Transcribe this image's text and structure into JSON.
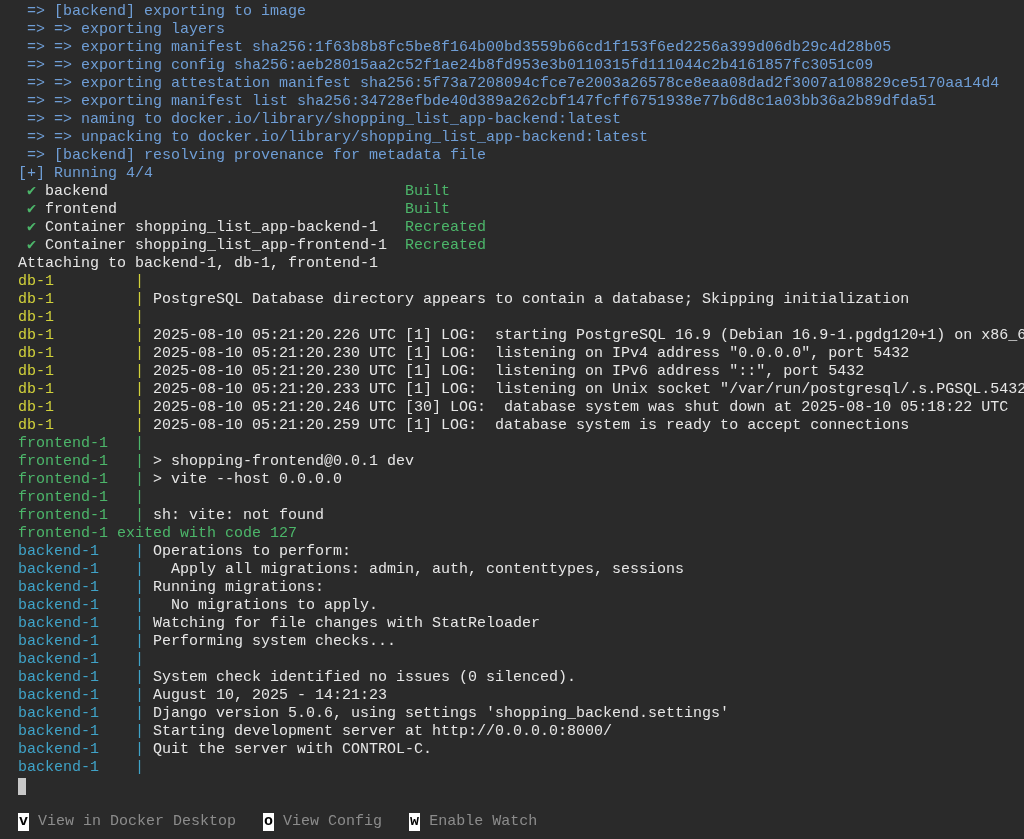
{
  "build_lines": [
    {
      "text": "=> [backend] exporting to image"
    },
    {
      "text": "=> => exporting layers"
    },
    {
      "text": "=> => exporting manifest sha256:1f63b8b8fc5be8f164b00bd3559b66cd1f153f6ed2256a399d06db29c4d28b05"
    },
    {
      "text": "=> => exporting config sha256:aeb28015aa2c52f1ae24b8fd953e3b0110315fd111044c2b4161857fc3051c09"
    },
    {
      "text": "=> => exporting attestation manifest sha256:5f73a7208094cfce7e2003a26578ce8eaa08dad2f3007a108829ce5170aa14d4"
    },
    {
      "text": "=> => exporting manifest list sha256:34728efbde40d389a262cbf147fcff6751938e77b6d8c1a03bb36a2b89dfda51"
    },
    {
      "text": "=> => naming to docker.io/library/shopping_list_app-backend:latest"
    },
    {
      "text": "=> => unpacking to docker.io/library/shopping_list_app-backend:latest"
    },
    {
      "text": "=> [backend] resolving provenance for metadata file"
    }
  ],
  "running": "[+] Running 4/4",
  "status_rows": [
    {
      "icon": "✔",
      "name": "backend",
      "result": "Built"
    },
    {
      "icon": "✔",
      "name": "frontend",
      "result": "Built"
    },
    {
      "icon": "✔",
      "name": "Container shopping_list_app-backend-1",
      "result": "Recreated"
    },
    {
      "icon": "✔",
      "name": "Container shopping_list_app-frontend-1",
      "result": "Recreated"
    }
  ],
  "attach_line": "Attaching to backend-1, db-1, frontend-1",
  "log_lines": [
    {
      "kind": "log",
      "service": "db-1",
      "color": "#d2d23a",
      "sep": "|"
    },
    {
      "kind": "log",
      "service": "db-1",
      "color": "#d2d23a",
      "sep": "|",
      "message": "PostgreSQL Database directory appears to contain a database; Skipping initialization"
    },
    {
      "kind": "log",
      "service": "db-1",
      "color": "#d2d23a",
      "sep": "|"
    },
    {
      "kind": "log",
      "service": "db-1",
      "color": "#d2d23a",
      "sep": "|",
      "message": "2025-08-10 05:21:20.226 UTC [1] LOG:  starting PostgreSQL 16.9 (Debian 16.9-1.pgdg120+1) on x86_6"
    },
    {
      "kind": "log",
      "service": "db-1",
      "color": "#d2d23a",
      "sep": "|",
      "message": "2025-08-10 05:21:20.230 UTC [1] LOG:  listening on IPv4 address \"0.0.0.0\", port 5432"
    },
    {
      "kind": "log",
      "service": "db-1",
      "color": "#d2d23a",
      "sep": "|",
      "message": "2025-08-10 05:21:20.230 UTC [1] LOG:  listening on IPv6 address \"::\", port 5432"
    },
    {
      "kind": "log",
      "service": "db-1",
      "color": "#d2d23a",
      "sep": "|",
      "message": "2025-08-10 05:21:20.233 UTC [1] LOG:  listening on Unix socket \"/var/run/postgresql/.s.PGSQL.5432"
    },
    {
      "kind": "log",
      "service": "db-1",
      "color": "#d2d23a",
      "sep": "|",
      "message": "2025-08-10 05:21:20.246 UTC [30] LOG:  database system was shut down at 2025-08-10 05:18:22 UTC"
    },
    {
      "kind": "log",
      "service": "db-1",
      "color": "#d2d23a",
      "sep": "|",
      "message": "2025-08-10 05:21:20.259 UTC [1] LOG:  database system is ready to accept connections"
    },
    {
      "kind": "log",
      "service": "frontend-1",
      "color": "#4cb66a",
      "sep": "|"
    },
    {
      "kind": "log",
      "service": "frontend-1",
      "color": "#4cb66a",
      "sep": "|",
      "message": "> shopping-frontend@0.0.1 dev"
    },
    {
      "kind": "log",
      "service": "frontend-1",
      "color": "#4cb66a",
      "sep": "|",
      "message": "> vite --host 0.0.0.0"
    },
    {
      "kind": "log",
      "service": "frontend-1",
      "color": "#4cb66a",
      "sep": "|"
    },
    {
      "kind": "log",
      "service": "frontend-1",
      "color": "#4cb66a",
      "sep": "|",
      "message": "sh: vite: not found"
    },
    {
      "kind": "exit",
      "service": "frontend-1",
      "color": "#4cb66a",
      "message": "exited with code 127"
    },
    {
      "kind": "log",
      "service": "backend-1",
      "color": "#3fa3c8",
      "sep": "|",
      "message": "Operations to perform:"
    },
    {
      "kind": "log",
      "service": "backend-1",
      "color": "#3fa3c8",
      "sep": "|",
      "message": "  Apply all migrations: admin, auth, contenttypes, sessions"
    },
    {
      "kind": "log",
      "service": "backend-1",
      "color": "#3fa3c8",
      "sep": "|",
      "message": "Running migrations:"
    },
    {
      "kind": "log",
      "service": "backend-1",
      "color": "#3fa3c8",
      "sep": "|",
      "message": "  No migrations to apply."
    },
    {
      "kind": "log",
      "service": "backend-1",
      "color": "#3fa3c8",
      "sep": "|",
      "message": "Watching for file changes with StatReloader"
    },
    {
      "kind": "log",
      "service": "backend-1",
      "color": "#3fa3c8",
      "sep": "|",
      "message": "Performing system checks..."
    },
    {
      "kind": "log",
      "service": "backend-1",
      "color": "#3fa3c8",
      "sep": "|"
    },
    {
      "kind": "log",
      "service": "backend-1",
      "color": "#3fa3c8",
      "sep": "|",
      "message": "System check identified no issues (0 silenced)."
    },
    {
      "kind": "log",
      "service": "backend-1",
      "color": "#3fa3c8",
      "sep": "|",
      "message": "August 10, 2025 - 14:21:23"
    },
    {
      "kind": "log",
      "service": "backend-1",
      "color": "#3fa3c8",
      "sep": "|",
      "message": "Django version 5.0.6, using settings 'shopping_backend.settings'"
    },
    {
      "kind": "log",
      "service": "backend-1",
      "color": "#3fa3c8",
      "sep": "|",
      "message": "Starting development server at http://0.0.0.0:8000/"
    },
    {
      "kind": "log",
      "service": "backend-1",
      "color": "#3fa3c8",
      "sep": "|",
      "message": "Quit the server with CONTROL-C."
    },
    {
      "kind": "log",
      "service": "backend-1",
      "color": "#3fa3c8",
      "sep": "|"
    }
  ],
  "shortcuts": [
    {
      "key": "v",
      "label": "View in Docker Desktop"
    },
    {
      "key": "o",
      "label": "View Config"
    },
    {
      "key": "w",
      "label": "Enable Watch"
    }
  ]
}
